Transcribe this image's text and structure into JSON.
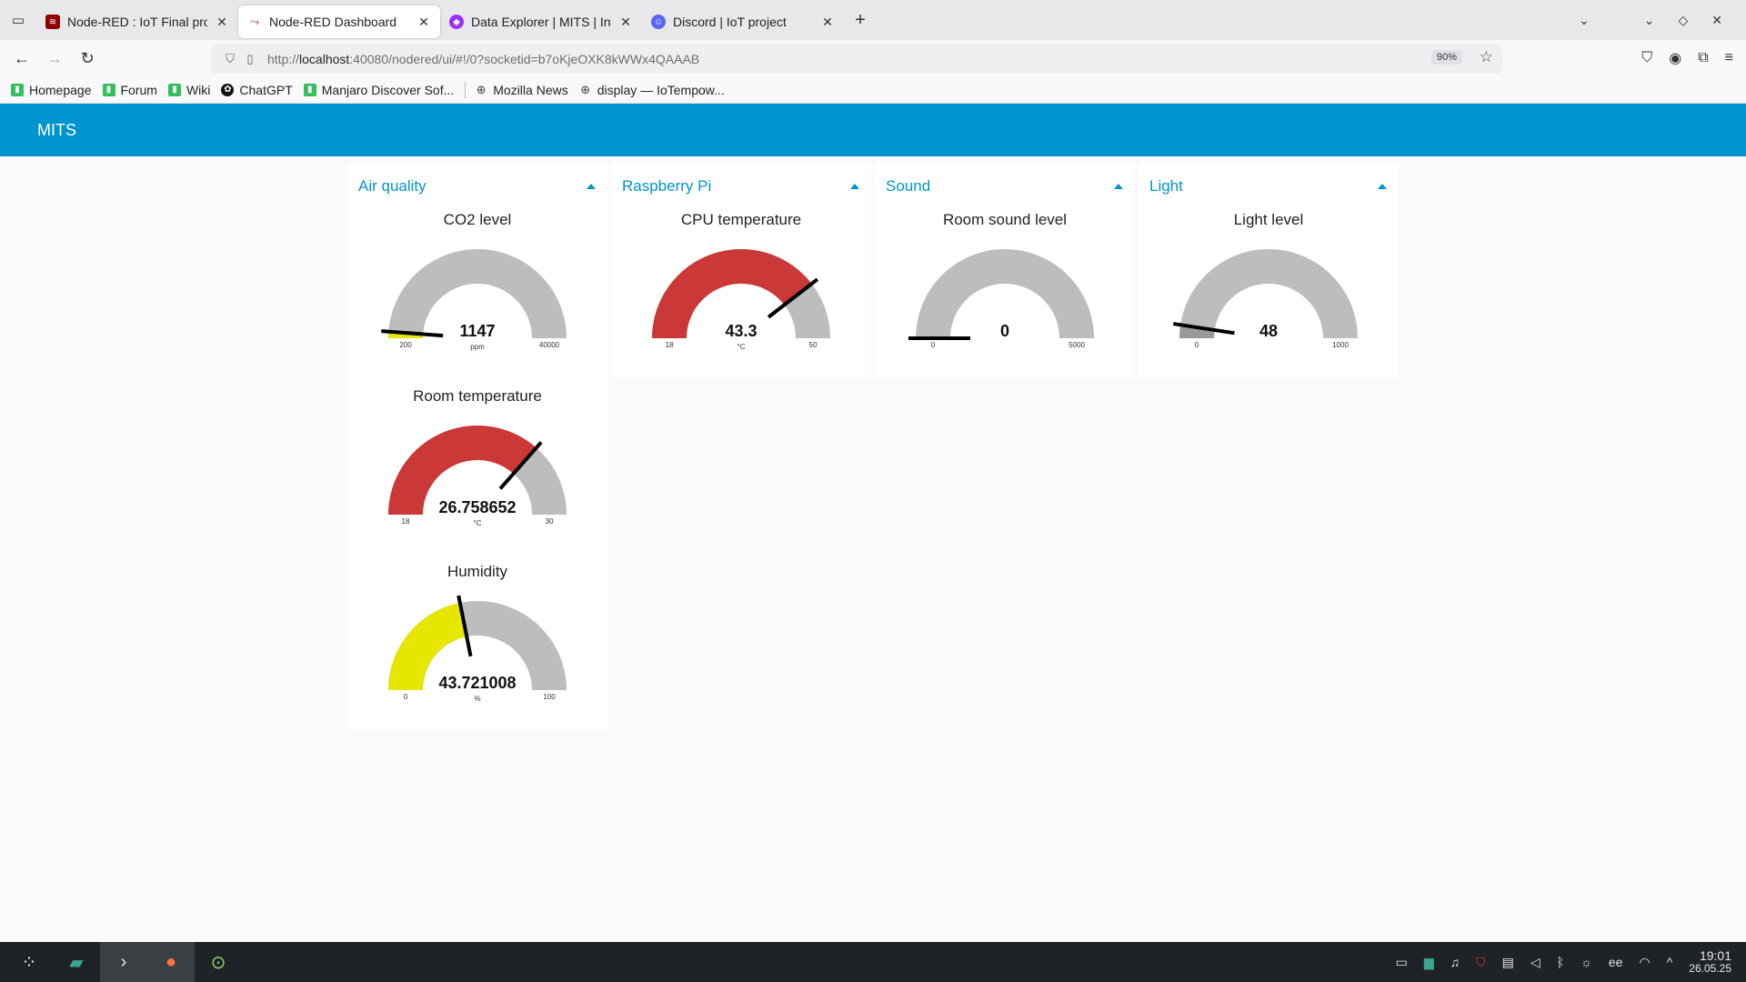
{
  "browser": {
    "tabs": [
      {
        "title": "Node-RED : IoT Final project",
        "active": false,
        "icon": "node-red-icon",
        "color": "#8f0000"
      },
      {
        "title": "Node-RED Dashboard",
        "active": true,
        "icon": "node-red-dashboard-icon",
        "color": "#aa3333"
      },
      {
        "title": "Data Explorer | MITS | Infl",
        "active": false,
        "icon": "influxdb-icon",
        "color": "#9b2fff"
      },
      {
        "title": "Discord | IoT project",
        "active": false,
        "icon": "discord-icon",
        "color": "#5865f2"
      }
    ],
    "new_tab_label": "+",
    "url_host": "localhost",
    "url_prefix": "http://",
    "url_suffix": ":40080/nodered/ui/#!/0?socketid=b7oKjeOXK8kWWx4QAAAB",
    "zoom": "90%",
    "bookmarks": [
      {
        "label": "Homepage",
        "icon": "manjaro-icon",
        "color": "#35bf5c"
      },
      {
        "label": "Forum",
        "icon": "manjaro-icon",
        "color": "#35bf5c"
      },
      {
        "label": "Wiki",
        "icon": "manjaro-icon",
        "color": "#35bf5c"
      },
      {
        "label": "ChatGPT",
        "icon": "chatgpt-icon",
        "color": "#111111"
      },
      {
        "label": "Manjaro Discover Sof...",
        "icon": "manjaro-icon",
        "color": "#35bf5c"
      },
      {
        "label": "Mozilla News",
        "icon": "globe-icon",
        "color": "#555555"
      },
      {
        "label": "display — IoTempow...",
        "icon": "globe-icon",
        "color": "#555555"
      }
    ]
  },
  "dashboard": {
    "title": "MITS",
    "accent": "#0094ce",
    "groups": [
      {
        "name": "Air quality",
        "gauges": [
          {
            "title": "CO2 level",
            "value": 1147,
            "display": "1147",
            "unit": "ppm",
            "min": 200,
            "max": 40000,
            "min_label": "200",
            "max_label": "40000",
            "color": "#e6e600"
          },
          {
            "title": "Room temperature",
            "value": 26.758652,
            "display": "26.758652",
            "unit": "°C",
            "min": 18,
            "max": 30,
            "min_label": "18",
            "max_label": "30",
            "color": "#ca3838"
          },
          {
            "title": "Humidity",
            "value": 43.721008,
            "display": "43.721008",
            "unit": "%",
            "min": 0,
            "max": 100,
            "min_label": "0",
            "max_label": "100",
            "color": "#e6e600"
          }
        ]
      },
      {
        "name": "Raspberry Pi",
        "gauges": [
          {
            "title": "CPU temperature",
            "value": 43.3,
            "display": "43.3",
            "unit": "°C",
            "min": 18,
            "max": 50,
            "min_label": "18",
            "max_label": "50",
            "color": "#ca3838"
          }
        ]
      },
      {
        "name": "Sound",
        "gauges": [
          {
            "title": "Room sound level",
            "value": 0,
            "display": "0",
            "unit": "",
            "min": 0,
            "max": 5000,
            "min_label": "0",
            "max_label": "5000",
            "color": "#00b500"
          }
        ]
      },
      {
        "name": "Light",
        "gauges": [
          {
            "title": "Light level",
            "value": 48,
            "display": "48",
            "unit": "",
            "min": 0,
            "max": 1000,
            "min_label": "0",
            "max_label": "1000",
            "color": "#999999"
          }
        ]
      }
    ]
  },
  "taskbar": {
    "keyboard_layout": "ee",
    "time": "19:01",
    "date": "26.05.25"
  }
}
